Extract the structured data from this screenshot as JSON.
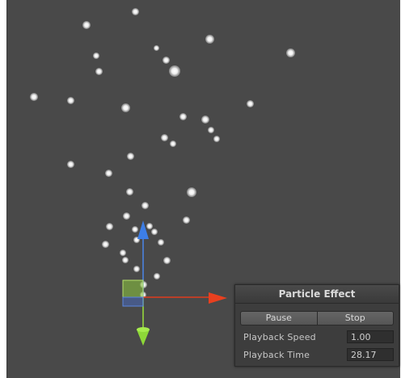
{
  "panel": {
    "title": "Particle Effect",
    "pause_label": "Pause",
    "stop_label": "Stop",
    "playback_speed_label": "Playback Speed",
    "playback_speed_value": "1.00",
    "playback_time_label": "Playback Time",
    "playback_time_value": "28.17"
  },
  "colors": {
    "scene_background": "#494949",
    "axis_x": "#e03c1e",
    "axis_y": "#9ae03c",
    "axis_z": "#4a86e8",
    "panel_background": "#3d3d3d"
  },
  "icons": [
    "transform-gizmo",
    "x-axis-arrow",
    "y-axis-arrow",
    "z-axis-arrow"
  ]
}
